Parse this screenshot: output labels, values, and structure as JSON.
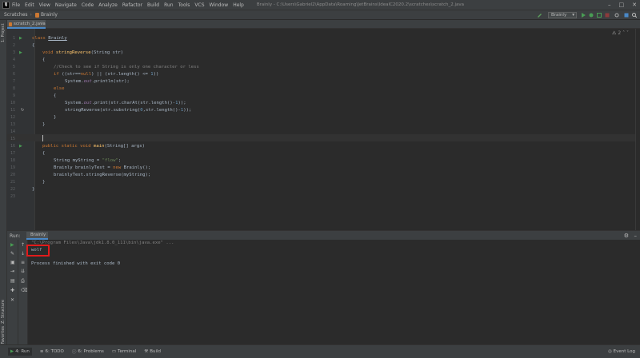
{
  "menubar": {
    "items": [
      "File",
      "Edit",
      "View",
      "Navigate",
      "Code",
      "Analyze",
      "Refactor",
      "Build",
      "Run",
      "Tools",
      "VCS",
      "Window",
      "Help"
    ],
    "window_title": "Brainly - C:\\Users\\Gabriel2\\AppData\\Roaming\\JetBrains\\IdeaIC2020.2\\scratches\\scratch_2.java"
  },
  "navbar": {
    "breadcrumb_root": "Scratches",
    "breadcrumb_class": "Brainly",
    "run_config": "Brainly"
  },
  "left_strip": {
    "project": "1: Project",
    "structure": "Z: Structure",
    "favorites": "2: Favorites"
  },
  "editor": {
    "tab_label": "scratch_2.java",
    "inspection_count": "2",
    "line_numbers": [
      "1",
      "2",
      "3",
      "4",
      "5",
      "6",
      "7",
      "8",
      "9",
      "10",
      "11",
      "12",
      "13",
      "14",
      "15",
      "16",
      "17",
      "18",
      "19",
      "20",
      "21",
      "22",
      "23"
    ],
    "code": {
      "l1_kw": "class ",
      "l1_name": "Brainly",
      "l2": "{",
      "l3_kw": "void ",
      "l3_fn": "stringReverse",
      "l3_rest": "(String str)",
      "l4": "{",
      "l5": "//Check to see if String is only one character or less",
      "l6_kw": "if ",
      "l6_a": "((str==",
      "l6_null": "null",
      "l6_b": ") || (str.length() <= ",
      "l6_num": "1",
      "l6_c": "))",
      "l7_a": "System.",
      "l7_out": "out",
      "l7_b": ".println(str);",
      "l8_kw": "else",
      "l9": "{",
      "l10_a": "System.",
      "l10_out": "out",
      "l10_b": ".print(str.charAt(str.length()-",
      "l10_num": "1",
      "l10_c": "));",
      "l11_a": "stringReverse(str.substring(",
      "l11_n0": "0",
      "l11_b": ",str.length()-",
      "l11_n1": "1",
      "l11_c": "));",
      "l12": "}",
      "l13": "}",
      "l14": "",
      "l15_kw": "public static void ",
      "l15_fn": "main",
      "l15_rest": "(String[] args)",
      "l16": "{",
      "l17_a": "String myString = ",
      "l17_str": "\"flow\"",
      "l17_b": ";",
      "l18_a": "Brainly brainlyTest = ",
      "l18_kw": "new ",
      "l18_b": "Brainly();",
      "l19": "brainlyTest.stringReverse(myString);",
      "l20": "}",
      "l21": "}"
    }
  },
  "run": {
    "panel_title": "Run:",
    "tab_label": "Brainly",
    "command": "\"C:\\Program Files\\Java\\jdk1.8.0_111\\bin\\java.exe\" ...",
    "output": "wolf",
    "exit_message": "Process finished with exit code 0"
  },
  "bottombar": {
    "items": [
      "4: Run",
      "6: TODO",
      "6: Problems",
      "Terminal",
      "Build"
    ],
    "event_log": "Event Log"
  },
  "colors": {
    "background": "#2b2b2b",
    "panel": "#3c3f41",
    "keyword": "#cc7832",
    "function": "#ffc66d",
    "comment": "#808080",
    "string": "#6a8759",
    "number": "#6897bb",
    "highlight_box": "#e21b1b"
  }
}
